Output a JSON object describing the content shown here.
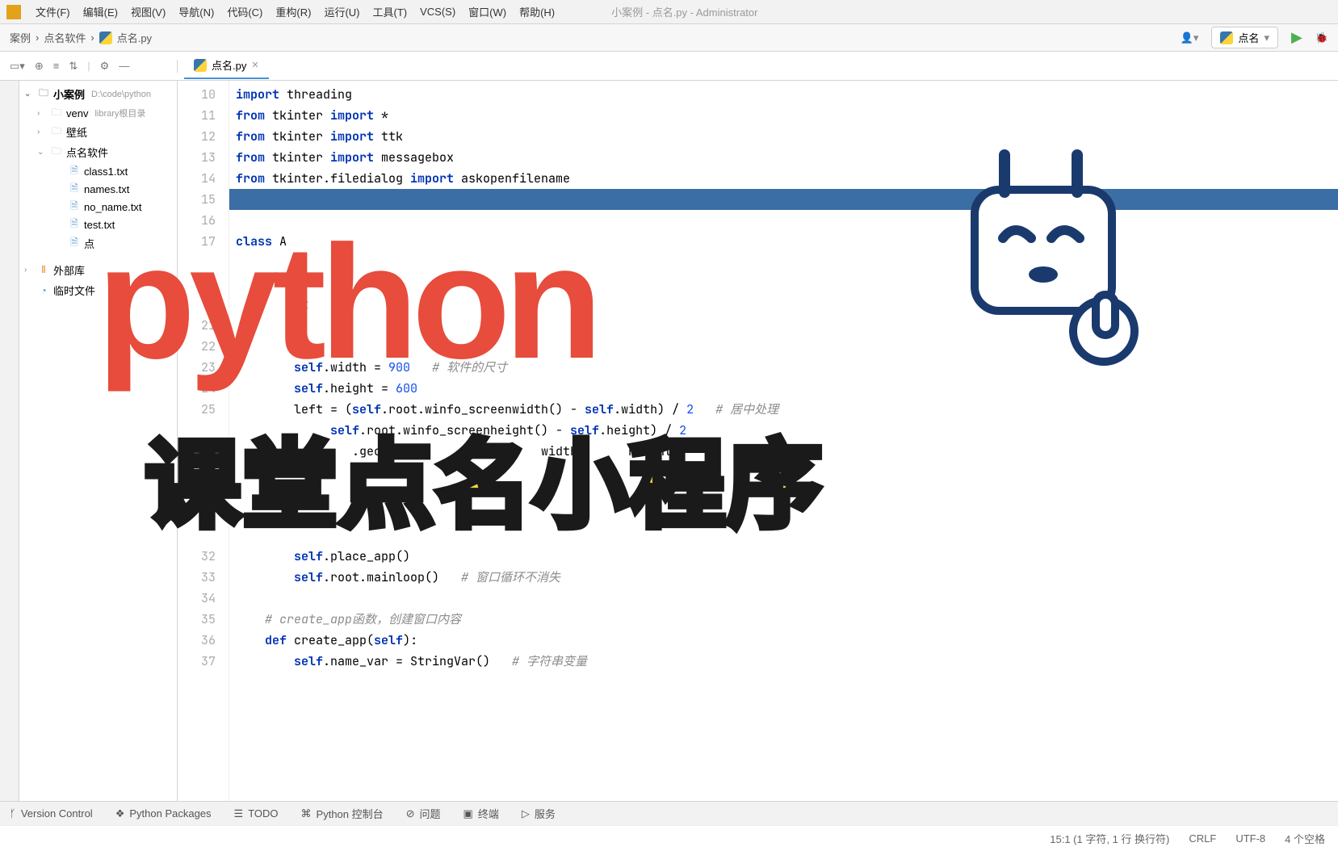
{
  "menubar": {
    "items": [
      "文件(F)",
      "编辑(E)",
      "视图(V)",
      "导航(N)",
      "代码(C)",
      "重构(R)",
      "运行(U)",
      "工具(T)",
      "VCS(S)",
      "窗口(W)",
      "帮助(H)"
    ],
    "title": "小案例 - 点名.py - Administrator"
  },
  "breadcrumb": {
    "items": [
      "案例",
      "点名软件",
      "点名.py"
    ],
    "run_config": "点名"
  },
  "editor_tab": {
    "name": "点名.py"
  },
  "project_tree": {
    "root": {
      "label": "小案例",
      "path": "D:\\code\\python"
    },
    "items": [
      {
        "type": "folder",
        "label": "venv",
        "hint": "library根目录",
        "indent": 1,
        "expand": "›"
      },
      {
        "type": "folder",
        "label": "壁纸",
        "indent": 1,
        "expand": "›"
      },
      {
        "type": "folder",
        "label": "点名软件",
        "indent": 1,
        "expand": "⌄"
      },
      {
        "type": "file",
        "label": "class1.txt",
        "indent": 2
      },
      {
        "type": "file",
        "label": "names.txt",
        "indent": 2
      },
      {
        "type": "file",
        "label": "no_name.txt",
        "indent": 2
      },
      {
        "type": "file",
        "label": "test.txt",
        "indent": 2
      },
      {
        "type": "file",
        "label": "点",
        "indent": 2
      }
    ],
    "extra": [
      {
        "label": "外部库",
        "icon": "lib"
      },
      {
        "label": "临时文件",
        "icon": "scratch"
      }
    ]
  },
  "gutter": [
    "10",
    "11",
    "12",
    "13",
    "14",
    "15",
    "16",
    "17",
    "",
    "",
    "",
    "21",
    "22",
    "23",
    "24",
    "25",
    "",
    "",
    "",
    "",
    "",
    "",
    "32",
    "33",
    "34",
    "35",
    "36",
    "37"
  ],
  "code_lines": [
    {
      "t": "import threading",
      "cls": ""
    },
    {
      "t": "from tkinter import *",
      "cls": ""
    },
    {
      "t": "from tkinter import ttk",
      "cls": ""
    },
    {
      "t": "from tkinter import messagebox",
      "cls": ""
    },
    {
      "t": "from tkinter.filedialog import askopenfilename",
      "cls": ""
    },
    {
      "t": "",
      "cls": "hl"
    },
    {
      "t": "",
      "cls": ""
    },
    {
      "t": "class A",
      "cls": ""
    },
    {
      "t": "",
      "cls": ""
    },
    {
      "t": "",
      "cls": ""
    },
    {
      "t": "        st    F",
      "cls": ""
    },
    {
      "t": "        n     5",
      "cls": ""
    },
    {
      "t": "        l",
      "cls": ""
    },
    {
      "t": "        self.width = 900   # 软件的尺寸",
      "cls": ""
    },
    {
      "t": "        self.height = 600",
      "cls": ""
    },
    {
      "t": "        left = (self.root.winfo_screenwidth() - self.width) / 2   # 居中处理",
      "cls": ""
    },
    {
      "t": "             self.root.winfo_screenheight() - self.height) / 2",
      "cls": ""
    },
    {
      "t": "                .geometry                 width       height",
      "cls": ""
    },
    {
      "t": "",
      "cls": ""
    },
    {
      "t": "",
      "cls": ""
    },
    {
      "t": "",
      "cls": ""
    },
    {
      "t": "",
      "cls": ""
    },
    {
      "t": "        self.place_app()",
      "cls": ""
    },
    {
      "t": "        self.root.mainloop()   # 窗口循环不消失",
      "cls": ""
    },
    {
      "t": "",
      "cls": ""
    },
    {
      "t": "    # create_app函数，创建窗口内容",
      "cls": ""
    },
    {
      "t": "    def create_app(self):",
      "cls": ""
    },
    {
      "t": "        self.name_var = StringVar()   # 字符串变量",
      "cls": ""
    }
  ],
  "overlay": {
    "title": "python",
    "subtitle": "课堂点名小程序"
  },
  "bottom_bar": {
    "items": [
      "Version Control",
      "Python Packages",
      "TODO",
      "Python 控制台",
      "问题",
      "终端",
      "服务"
    ]
  },
  "status_bar": {
    "pos": "15:1 (1 字符, 1 行 换行符)",
    "eol": "CRLF",
    "enc": "UTF-8",
    "indent": "4 个空格"
  }
}
